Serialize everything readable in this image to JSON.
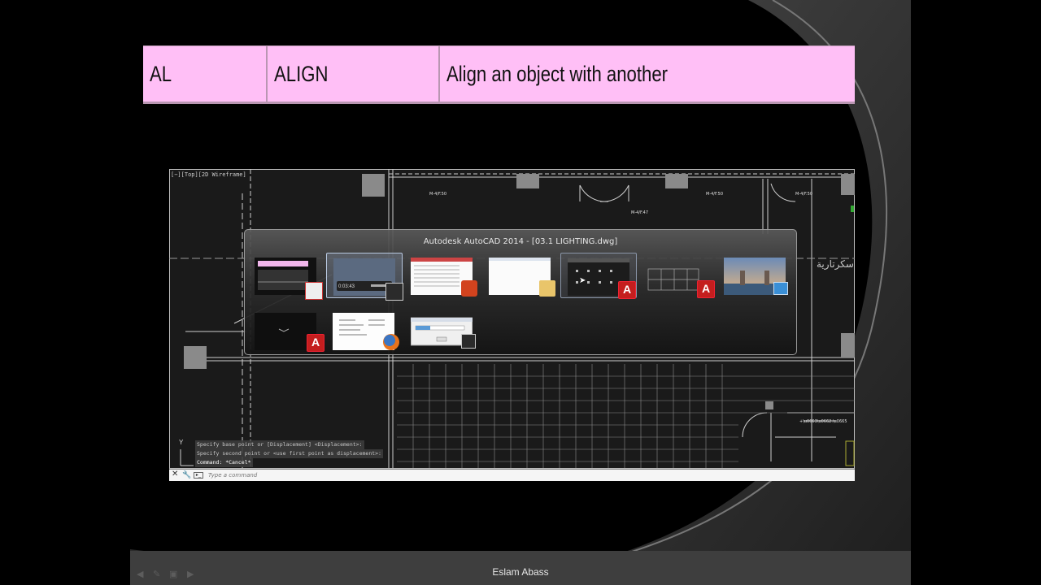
{
  "table_row": {
    "alias": "AL",
    "command": "ALIGN",
    "description": "Align an object with another"
  },
  "autocad": {
    "viewport_label": "[−][Top][2D Wireframe]",
    "arabic_room_label": "سكرتارية",
    "command_history": [
      "Specify base point or [Displacement] <Displacement>:",
      "Specify second point or <use first point as displacement>:",
      "Command: *Cancel*"
    ],
    "command_placeholder": "Type a command",
    "axis_label": "Y"
  },
  "switcher": {
    "title": "Autodesk AutoCAD 2014 - [03.1 LIGHTING.dwg]",
    "thumb_time": "0:03:43",
    "windows": [
      {
        "app": "powerpoint",
        "badge": "powerpoint-icon"
      },
      {
        "app": "video-player",
        "badge": "video-icon",
        "selected": true
      },
      {
        "app": "acrobat",
        "badge": "acrobat-icon"
      },
      {
        "app": "explorer",
        "badge": "folder-icon"
      },
      {
        "app": "autocad",
        "badge": "autocad-icon",
        "hover": true
      },
      {
        "app": "autocad",
        "badge": "autocad-icon"
      },
      {
        "app": "photo-viewer",
        "badge": "photo-viewer-icon"
      },
      {
        "app": "autocad",
        "badge": "autocad-icon"
      },
      {
        "app": "firefox",
        "badge": "firefox-icon"
      },
      {
        "app": "progress-dialog",
        "badge": "video-icon"
      }
    ]
  },
  "footer": {
    "author": "Eslam Abass"
  },
  "colors": {
    "table_bg": "#ffbff6",
    "cad_bg": "#1a1a1a",
    "autocad_red": "#c41e1e"
  }
}
